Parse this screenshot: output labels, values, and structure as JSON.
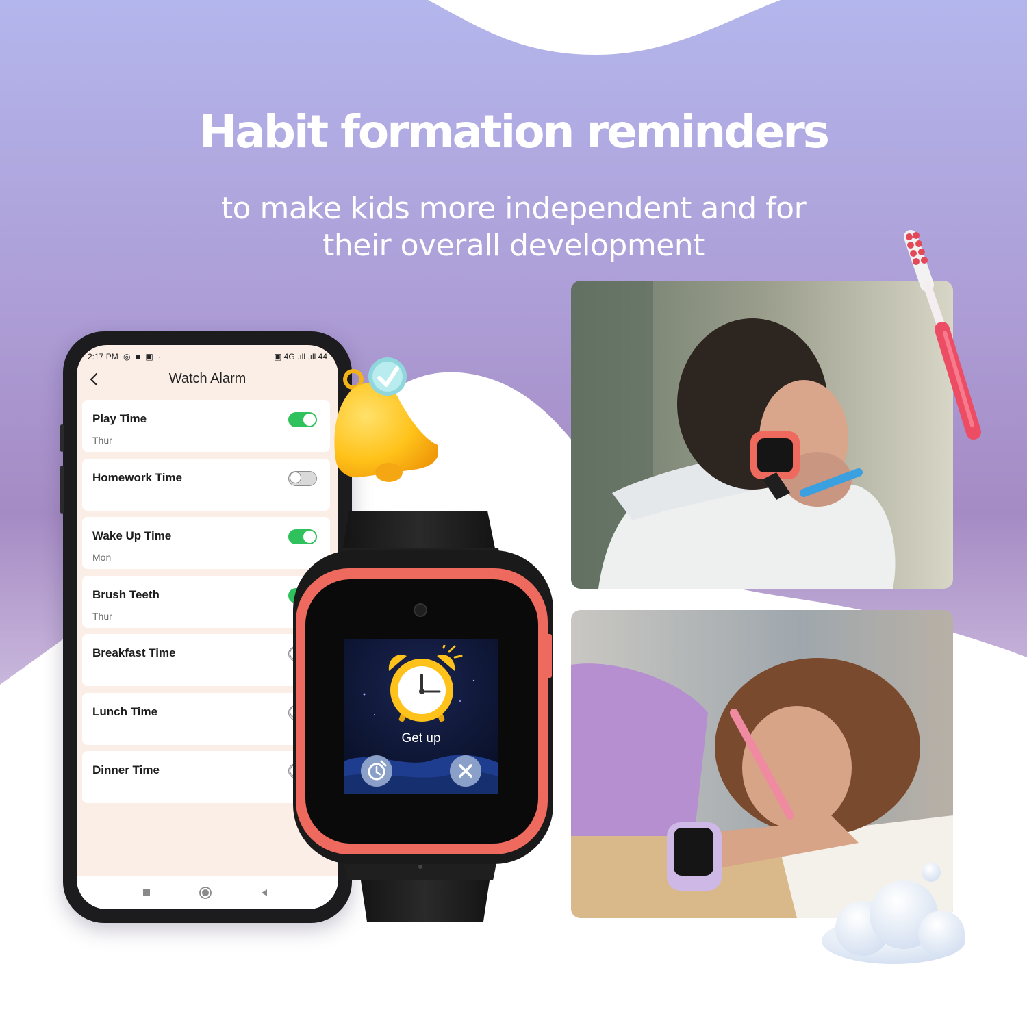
{
  "headline": "Habit formation reminders",
  "subline": [
    "to make kids more independent and for",
    "their overall development"
  ],
  "phone": {
    "status_time": "2:17 PM",
    "status_icons_left": "◎ ■ ▣ ·",
    "status_icons_right": "▣ 4G .ıll .ıll 44",
    "title": "Watch Alarm",
    "alarms": [
      {
        "name": "Play Time",
        "day": "Thur",
        "enabled": true
      },
      {
        "name": "Homework Time",
        "day": "",
        "enabled": false
      },
      {
        "name": "Wake Up Time",
        "day": "Mon",
        "enabled": true
      },
      {
        "name": "Brush Teeth",
        "day": "Thur",
        "enabled": true
      },
      {
        "name": "Breakfast Time",
        "day": "",
        "enabled": false
      },
      {
        "name": "Lunch Time",
        "day": "",
        "enabled": false
      },
      {
        "name": "Dinner Time",
        "day": "",
        "enabled": false
      }
    ],
    "nav_icons": [
      "square-nav-icon",
      "home-circle-icon",
      "back-triangle-icon"
    ]
  },
  "watch": {
    "label": "Get up",
    "icons": [
      "alarm-clock-icon",
      "snooze-icon",
      "dismiss-icon"
    ]
  },
  "colors": {
    "bg_purple": "#b3b0e6",
    "bg_mauve": "#a98cc3",
    "toggle_on": "#2fc15b",
    "watch_bezel": "#ef6a5f",
    "bell_yellow": "#ffc21a"
  }
}
